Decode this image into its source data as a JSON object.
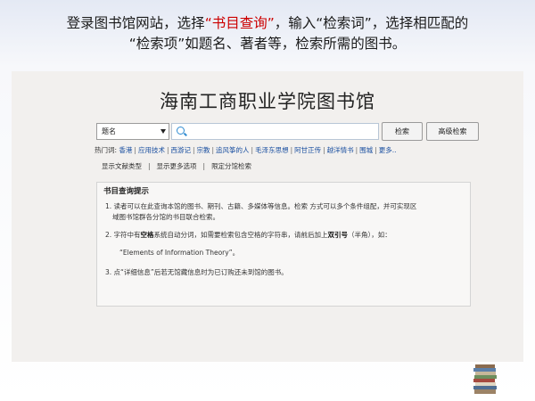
{
  "instruction": {
    "line1_a": "登录图书馆网站，选择",
    "line1_hl": "“书目查询”",
    "line1_b": "，输入“检索词”，选择相匹配的",
    "line2": "“检索项”如题名、著者等，检索所需的图书。",
    "highlight_color": "#cc0000"
  },
  "site": {
    "title": "海南工商职业学院图书馆"
  },
  "search": {
    "field_selected": "题名",
    "query_value": "",
    "search_label": "检索",
    "advanced_label": "高级检索"
  },
  "hotwords": {
    "label": "热门词:",
    "items": [
      "香港",
      "应用技术",
      "西游记",
      "宗教",
      "追风筝的人",
      "毛泽东思想",
      "阿甘正传",
      "越洋情书",
      "围城",
      "更多.."
    ]
  },
  "options": {
    "items": [
      "显示文献类型",
      "显示更多选项",
      "限定分馆检索"
    ]
  },
  "tips": {
    "title": "书目查询提示",
    "t1_line1": "1. 读者可以在此查询本馆的图书、期刊、古籍、多媒体等信息。检索 方式可以多个条件组配，并可实现区",
    "t1_line2": "域图书馆群各分馆的书目联合检索。",
    "t2_a": "2. 字符中有",
    "t2_b1": "空格",
    "t2_c": "系统自动分词，如需要检索包含空格的字符串，请前后加上",
    "t2_b2": "双引号",
    "t2_d": "（半角），如：",
    "t2_example": "“Elements of Information Theory”。",
    "t3": "3. 点“详细信息”后若无馆藏信息时为已订购还未到馆的图书。"
  },
  "icons": {
    "search": "magnifier-icon",
    "select_arrow": "chevron-down-icon",
    "decor": "book-stack-icon"
  }
}
